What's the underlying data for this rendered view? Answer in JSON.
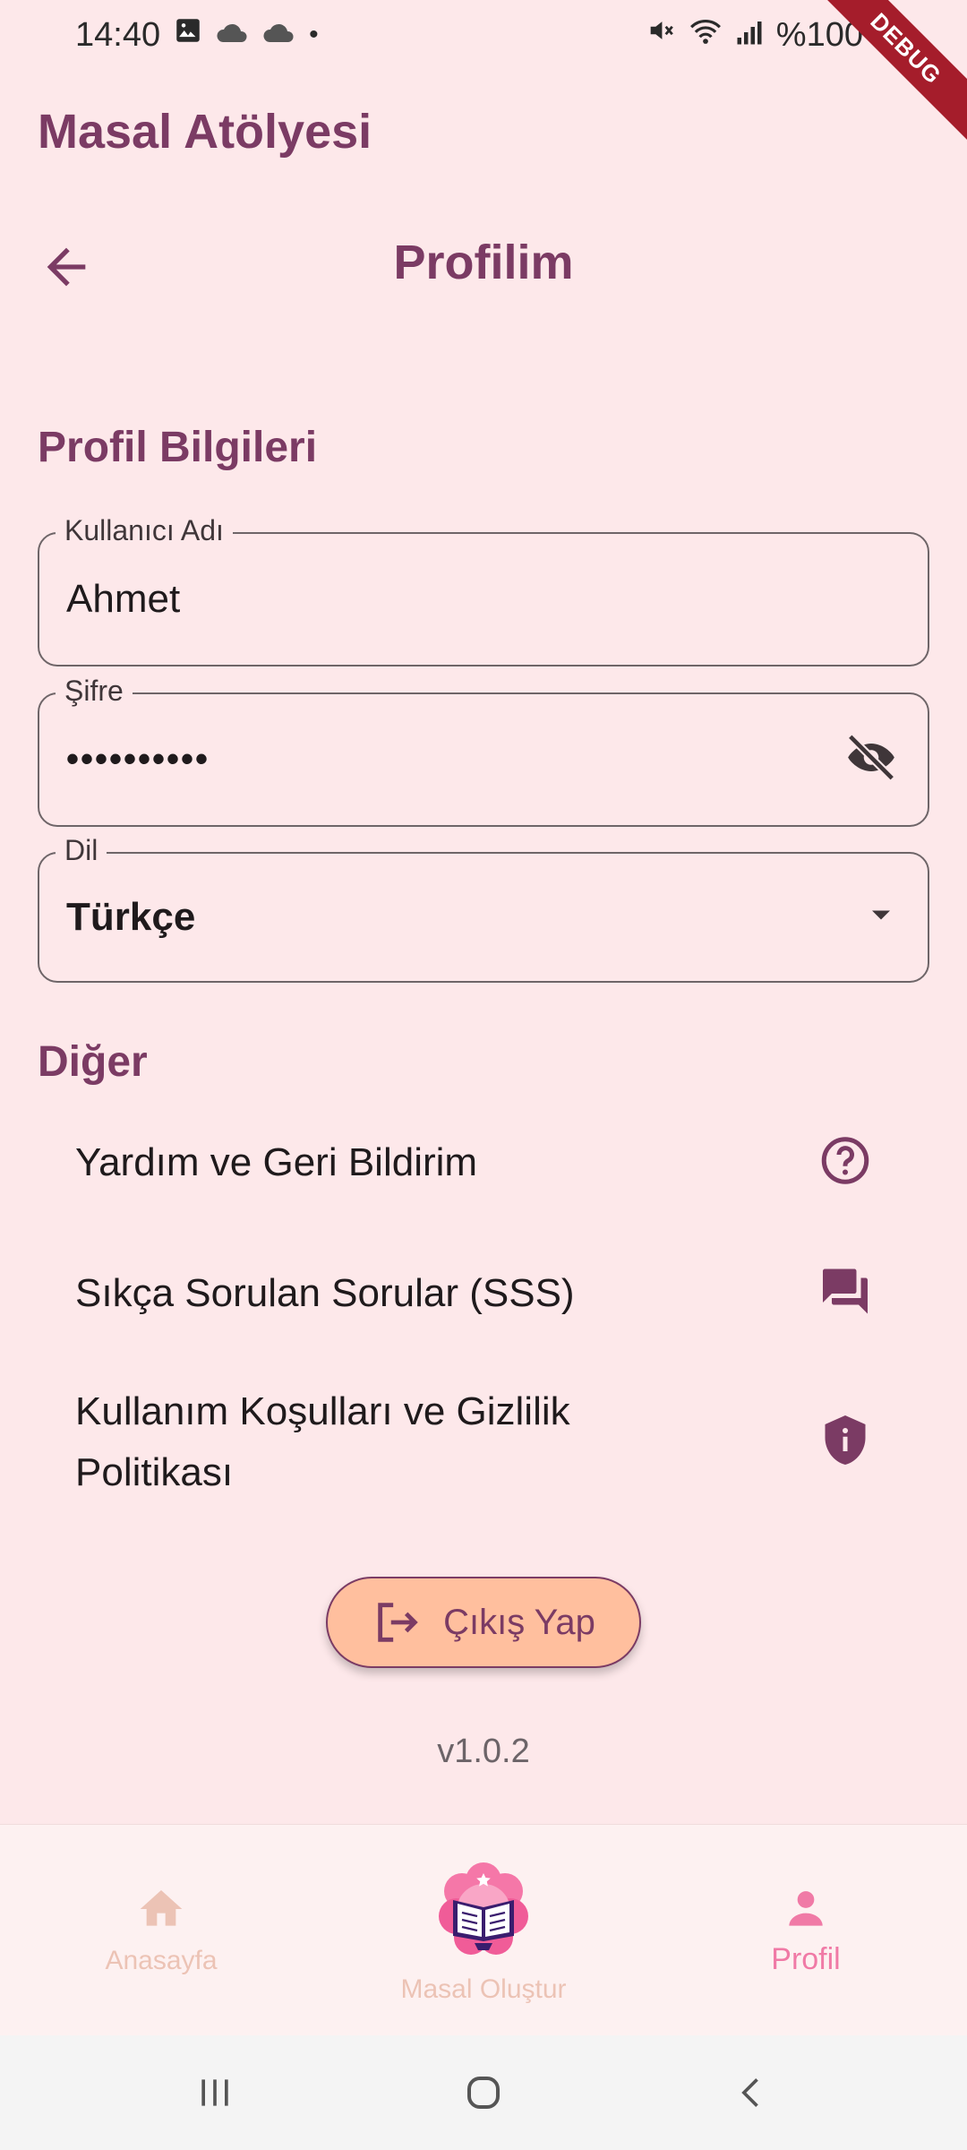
{
  "status_bar": {
    "time": "14:40",
    "dot": "•",
    "battery_text": "%100",
    "icons": [
      "image-icon",
      "cloud-icon",
      "cloud-icon",
      "mute-icon",
      "wifi-icon",
      "signal-icon",
      "battery-icon"
    ]
  },
  "debug_banner": "DEBUG",
  "app": {
    "title": "Masal Atölyesi"
  },
  "top_bar": {
    "title": "Profilim",
    "back_icon": "arrow-back-icon"
  },
  "profile": {
    "section_title": "Profil Bilgileri",
    "username": {
      "label": "Kullanıcı Adı",
      "value": "Ahmet"
    },
    "password": {
      "label": "Şifre",
      "value": "••••••••••",
      "toggle_icon": "eye-off-icon"
    },
    "language": {
      "label": "Dil",
      "value": "Türkçe",
      "dropdown_icon": "dropdown-arrow-icon"
    }
  },
  "other": {
    "section_title": "Diğer",
    "items": [
      {
        "label": "Yardım ve Geri Bildirim",
        "icon": "help-circle-icon"
      },
      {
        "label": "Sıkça Sorulan Sorular (SSS)",
        "icon": "forum-icon"
      },
      {
        "label_line1": "Kullanım Koşulları ve Gizlilik",
        "label_line2": "Politikası",
        "icon": "shield-info-icon"
      }
    ]
  },
  "logout": {
    "label": "Çıkış Yap",
    "icon": "logout-icon"
  },
  "version": "v1.0.2",
  "bottom_nav": {
    "items": [
      {
        "label": "Anasayfa",
        "icon": "home-icon",
        "active": false
      },
      {
        "label": "Masal Oluştur",
        "icon": "story-book-logo",
        "active": false
      },
      {
        "label": "Profil",
        "icon": "person-icon",
        "active": true
      }
    ]
  },
  "colors": {
    "background": "#fde8ea",
    "primary": "#7b3b64",
    "logout_fill": "#ffbf9e",
    "nav_active": "#f07aa6",
    "nav_inactive": "#ecc3b5"
  }
}
